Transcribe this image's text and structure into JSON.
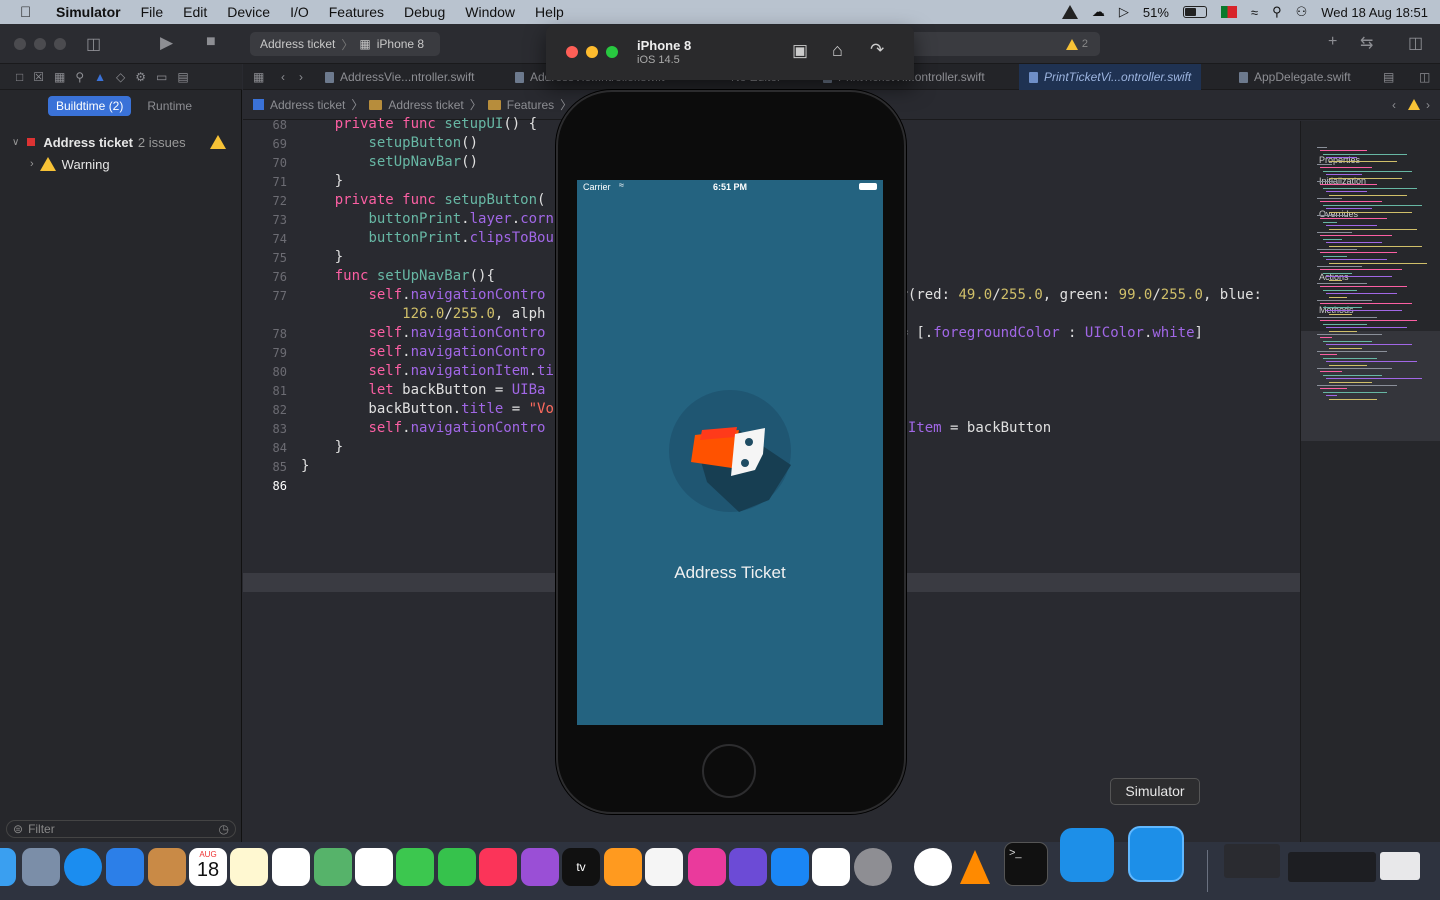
{
  "menubar": {
    "app": "Simulator",
    "items": [
      "File",
      "Edit",
      "Device",
      "I/O",
      "Features",
      "Debug",
      "Window",
      "Help"
    ],
    "battery": "51%",
    "clock": "Wed 18 Aug  18:51"
  },
  "toolbar": {
    "scheme_project": "Address ticket",
    "scheme_device": "iPhone 8",
    "warning_count": "2"
  },
  "navigator": {
    "seg_buildtime": "Buildtime (2)",
    "seg_runtime": "Runtime",
    "project": "Address ticket",
    "project_issues": "2 issues",
    "warning_label": "Warning",
    "filter_placeholder": "Filter"
  },
  "tabs": [
    {
      "label": "AddressVie...ntroller.swift"
    },
    {
      "label": "AddressVie...ntroller.swift"
    },
    {
      "label": "No Editor"
    },
    {
      "label": "PrintTicketVi...ontroller.swift"
    },
    {
      "label": "PrintTicketVi...ontroller.swift"
    },
    {
      "label": "AppDelegate.swift"
    }
  ],
  "jumpbar": [
    "Address ticket",
    "Address ticket",
    "Features"
  ],
  "code_lines": [
    {
      "n": "68",
      "html": "    <span class='kw'>private func</span> <span class='fn'>setupUI</span>() {"
    },
    {
      "n": "69",
      "html": "        <span class='fn'>setupButton</span>()"
    },
    {
      "n": "70",
      "html": "        <span class='fn'>setUpNavBar</span>()"
    },
    {
      "n": "71",
      "html": "    }"
    },
    {
      "n": "72",
      "html": "    <span class='kw'>private func</span> <span class='fn'>setupButton</span>("
    },
    {
      "n": "73",
      "html": "        <span class='fn'>buttonPrint</span>.<span class='pr'>layer</span>.<span class='pr'>corn</span>"
    },
    {
      "n": "74",
      "html": "        <span class='fn'>buttonPrint</span>.<span class='pr'>clipsToBou</span>"
    },
    {
      "n": "75",
      "html": "    }"
    },
    {
      "n": "76",
      "html": "    <span class='kw'>func</span> <span class='fn'>setUpNavBar</span>(){"
    },
    {
      "n": "77",
      "html": "        <span class='kw'>self</span>.<span class='pr'>navigationContro</span>                                          r(red: <span class='nm'>49.0</span>/<span class='nm'>255.0</span>, green: <span class='nm'>99.0</span>/<span class='nm'>255.0</span>, blue:"
    },
    {
      "n": "",
      "html": "            <span class='nm'>126.0</span>/<span class='nm'>255.0</span>, alph"
    },
    {
      "n": "78",
      "html": "        <span class='kw'>self</span>.<span class='pr'>navigationContro</span>                                          = [.<span class='pr'>foregroundColor</span> : <span class='pr'>UIColor</span>.<span class='pr'>white</span>]"
    },
    {
      "n": "79",
      "html": "        <span class='kw'>self</span>.<span class='pr'>navigationContro</span>"
    },
    {
      "n": "80",
      "html": "        <span class='kw'>self</span>.<span class='pr'>navigationItem</span>.<span class='pr'>ti</span>"
    },
    {
      "n": "81",
      "html": "        <span class='kw'>let</span> backButton = <span class='pr'>UIBa</span>"
    },
    {
      "n": "82",
      "html": "        backButton.<span class='pr'>title</span> = <span class='str'>\"Vo</span>"
    },
    {
      "n": "83",
      "html": "        <span class='kw'>self</span>.<span class='pr'>navigationContro</span>                                          <span class='pr'>nItem</span> = backButton"
    },
    {
      "n": "84",
      "html": "    }"
    },
    {
      "n": "85",
      "html": "}"
    },
    {
      "n": "86",
      "html": ""
    }
  ],
  "minimap_headings": [
    "Properties",
    "Initialization",
    "Overrides",
    "Actions",
    "Methods"
  ],
  "simulator": {
    "device": "iPhone 8",
    "os": "iOS 14.5",
    "carrier": "Carrier",
    "time": "6:51 PM",
    "app_title": "Address Ticket"
  },
  "dock": {
    "tooltip": "Simulator",
    "calendar_month": "AUG",
    "calendar_day": "18"
  },
  "colors": {
    "screen_bg": "#246380",
    "accent": "#3a72d8",
    "warning": "#f7c236"
  }
}
